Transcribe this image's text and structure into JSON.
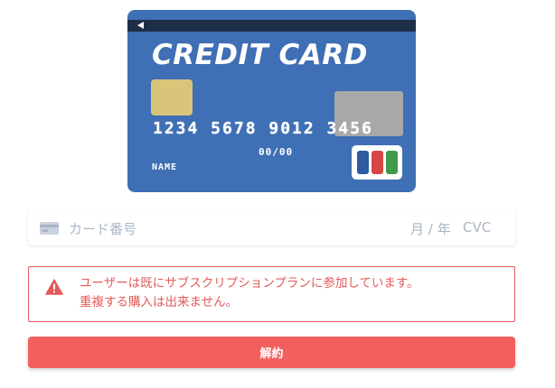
{
  "card_illustration": {
    "title": "CREDIT CARD",
    "number": "1234 5678 9012 3456",
    "expiry": "00/00",
    "name": "NAME",
    "brand_colors": [
      "#2d5aa0",
      "#d64545",
      "#3f9b4a"
    ]
  },
  "card_input": {
    "placeholder": "カード番号",
    "expiry_placeholder": "月 / 年",
    "cvc_placeholder": "CVC"
  },
  "alert": {
    "lines": [
      "ユーザーは既にサブスクリプションプランに参加しています。",
      "重複する購入は出来ません。"
    ],
    "color": "#e25b59"
  },
  "action": {
    "cancel_label": "解約",
    "color": "#f1605f"
  }
}
